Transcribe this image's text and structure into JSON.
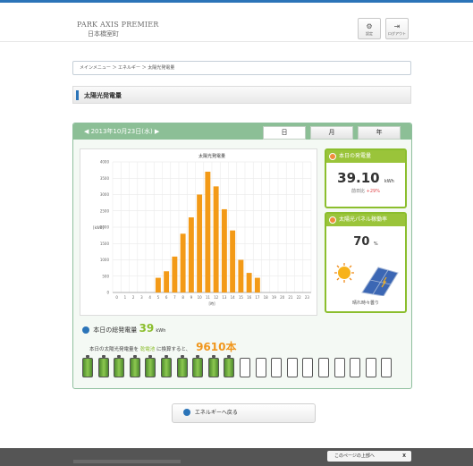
{
  "header": {
    "brand_en": "PARK AXIS PREMIER",
    "brand_jp": "日本橋室町",
    "settings_label": "設定",
    "logout_label": "ログアウト"
  },
  "breadcrumb": {
    "text": "メインメニュー ＞ エネルギー ＞ 太陽光発電量"
  },
  "page": {
    "title": "太陽光発電量"
  },
  "panel": {
    "date_label": "◀   2013年10月23日(水)   ▶",
    "tabs": [
      "日",
      "月",
      "年"
    ],
    "active_tab": "日"
  },
  "chart_data": {
    "type": "bar",
    "title": "太陽光発電量",
    "ylabel": "[kWh]",
    "xlabel": "[時]",
    "ylim": [
      0,
      4000
    ],
    "yticks": [
      0,
      500,
      1000,
      1500,
      2000,
      2500,
      3000,
      3500,
      4000
    ],
    "categories": [
      "0",
      "1",
      "2",
      "3",
      "4",
      "5",
      "6",
      "7",
      "8",
      "9",
      "10",
      "11",
      "12",
      "13",
      "14",
      "15",
      "16",
      "17",
      "18",
      "19",
      "20",
      "21",
      "22",
      "23"
    ],
    "values": [
      0,
      0,
      0,
      0,
      0,
      450,
      650,
      1100,
      1800,
      2300,
      3000,
      3700,
      3250,
      2550,
      1900,
      1000,
      600,
      450,
      0,
      0,
      0,
      0,
      0,
      0
    ],
    "bar_color": "#f39a17"
  },
  "today_generation": {
    "title": "本日の発電量",
    "value": "39.10",
    "unit": "kWh",
    "compare_label": "前日比",
    "compare_value": "+29%"
  },
  "efficiency": {
    "title": "太陽光パネル稼働率",
    "value": "70",
    "unit": "%",
    "weather": "晴れ時々曇り"
  },
  "summary": {
    "total_label": "本日の総発電量",
    "total_value": "39",
    "total_unit": "kWh",
    "conversion_prefix": "本日の太陽光発電量を",
    "battery_word": "乾電池",
    "conversion_suffix": "に換算すると、",
    "battery_count": "9610本",
    "cells_total": 20,
    "cells_filled": 10
  },
  "back_button": {
    "label": "エネルギーへ戻る"
  },
  "footer": {
    "to_top_label": "このページの上部へ",
    "close_label": "X"
  }
}
